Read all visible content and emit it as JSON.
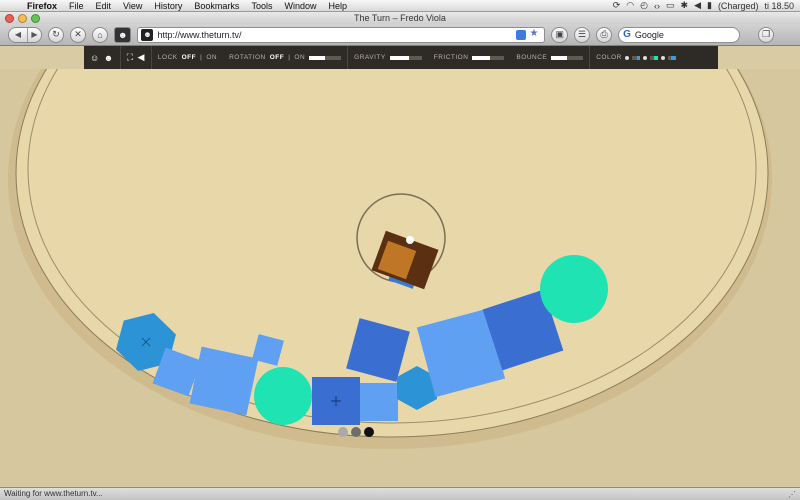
{
  "menubar": {
    "app": "Firefox",
    "items": [
      "File",
      "Edit",
      "View",
      "History",
      "Bookmarks",
      "Tools",
      "Window",
      "Help"
    ],
    "battery": "(Charged)",
    "clock": "ti 18.50"
  },
  "window": {
    "title": "The Turn – Fredo Viola"
  },
  "toolbar": {
    "url": "http://www.theturn.tv/",
    "search_placeholder": "Google"
  },
  "sitebar": {
    "lock_label": "LOCK",
    "lock_off": "OFF",
    "lock_on": "ON",
    "rotation_label": "ROTATION",
    "rotation_off": "OFF",
    "rotation_on": "ON",
    "gravity_label": "GRAVITY",
    "friction_label": "FRICTION",
    "bounce_label": "BOUNCE",
    "color_label": "COLOR",
    "rotation_level": 0.5,
    "gravity_level": 0.6,
    "friction_level": 0.55,
    "bounce_level": 0.5
  },
  "pager": {
    "dots": 3,
    "active": 3
  },
  "status": {
    "text": "Waiting for www.theturn.tv..."
  },
  "colors": {
    "bowl": "#e8d7a8",
    "shape_light": "#5fa0f2",
    "shape_mid": "#3a6ed0",
    "shape_cyan": "#2b93d6",
    "circle": "#1fe3b3"
  }
}
